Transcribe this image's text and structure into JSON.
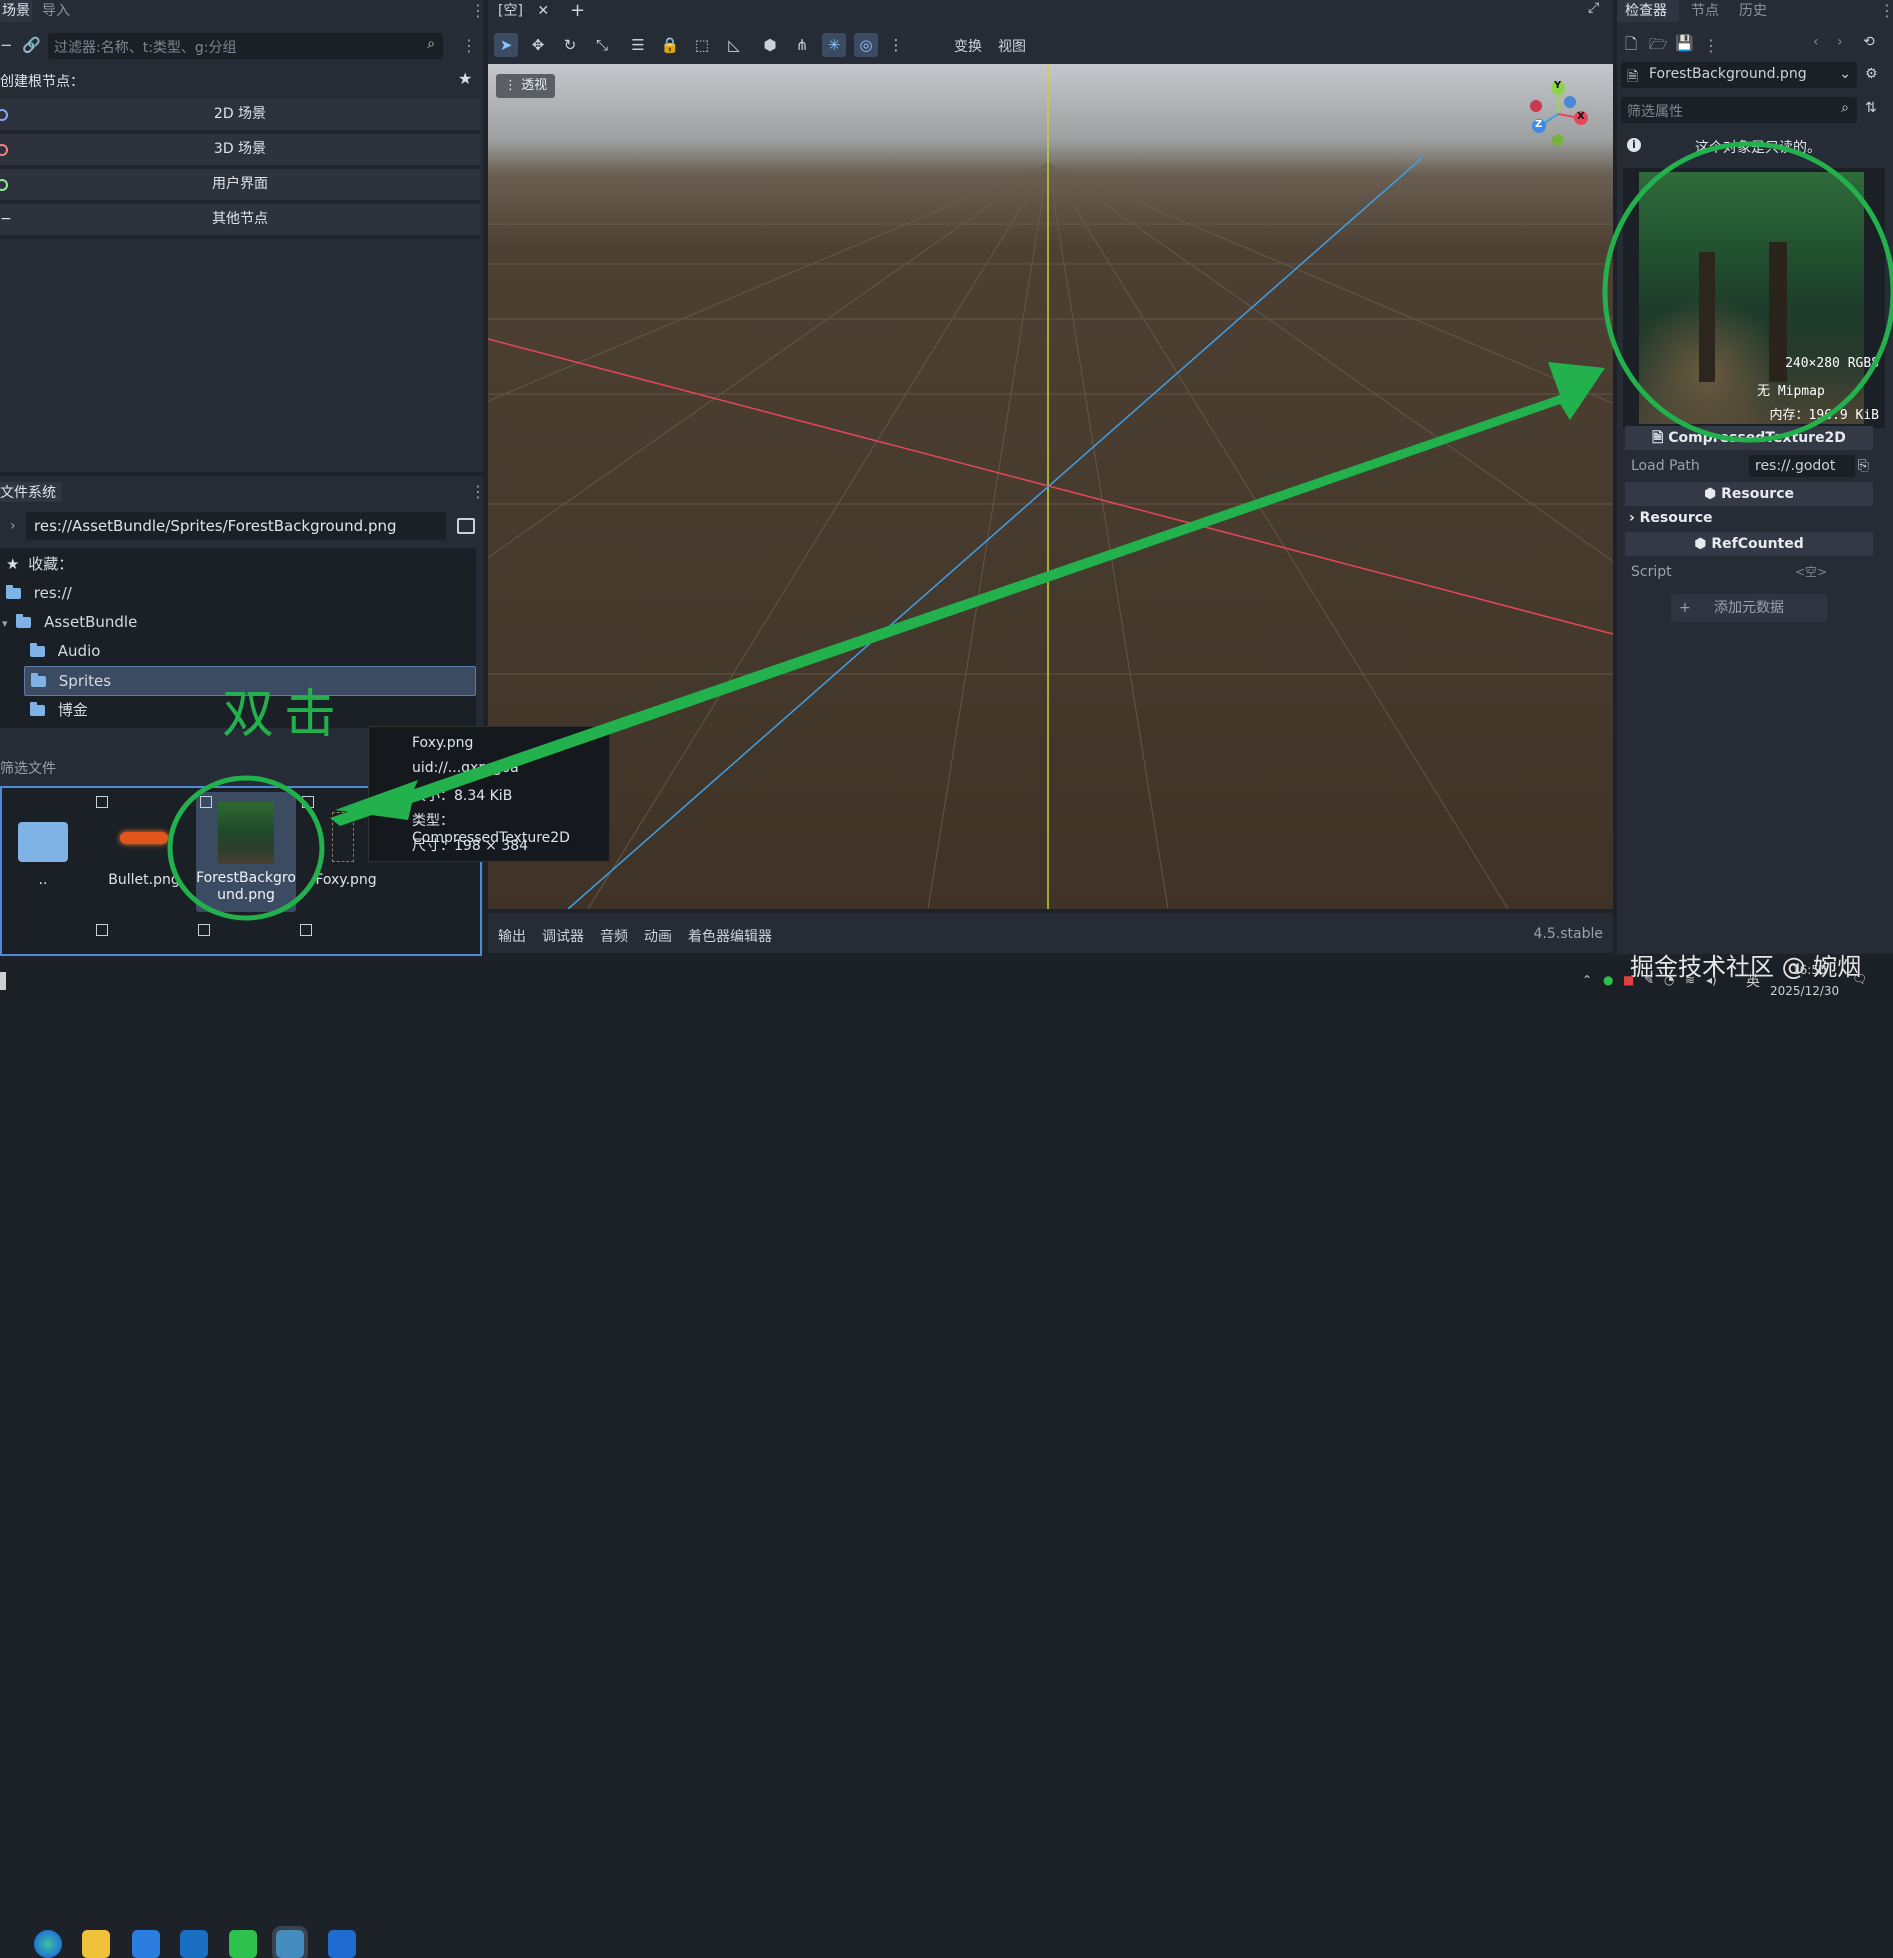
{
  "left_top": {
    "tabs": [
      "场景",
      "导入"
    ],
    "filter_placeholder": "过滤器:名称、t:类型、g:分组",
    "create_root_label": "创建根节点：",
    "node_buttons": [
      "2D 场景",
      "3D 场景",
      "用户界面",
      "其他节点"
    ]
  },
  "filesystem": {
    "title": "文件系统",
    "path": "res://AssetBundle/Sprites/ForestBackground.png",
    "tree": [
      {
        "label": "收藏："
      },
      {
        "label": "res://"
      },
      {
        "label": "AssetBundle"
      },
      {
        "label": "Audio"
      },
      {
        "label": "Sprites"
      },
      {
        "label": "博金"
      }
    ],
    "filter_files_label": "筛选文件",
    "files": [
      "..",
      "Bullet.png",
      "ForestBackground.png",
      "Foxy.png"
    ],
    "files_display": [
      "..",
      "Bullet.png",
      "ForestBackgro\nund.png",
      "Foxy.png"
    ],
    "handwriting": "双击"
  },
  "tooltip": {
    "name": "Foxy.png",
    "uid": "uid://...qxprgoa",
    "size": "大小：8.34 KiB",
    "type": "类型：CompressedTexture2D",
    "dims": "尺寸：198 × 384"
  },
  "viewport": {
    "scene_tab": "[空]",
    "menus": [
      "变换",
      "视图"
    ],
    "perspective_label": "透视",
    "gizmo_axes": [
      "Y",
      "X",
      "Z"
    ]
  },
  "bottom_bar": {
    "tabs": [
      "输出",
      "调试器",
      "音频",
      "动画",
      "着色器编辑器"
    ],
    "version": "4.5.stable"
  },
  "inspector": {
    "tabs": [
      "检查器",
      "节点",
      "历史"
    ],
    "resource_name": "ForestBackground.png",
    "filter_placeholder": "筛选属性",
    "readonly_notice": "这个对象是只读的。",
    "image_info": [
      "240×280 RGB8",
      "无 Mipmap",
      "内存：196.9 KiB"
    ],
    "class_header": "CompressedTexture2D",
    "load_path_label": "Load Path",
    "load_path_value": "res://.godot",
    "resource_header": "Resource",
    "resource_sub": "Resource",
    "refcounted_header": "RefCounted",
    "script_label": "Script",
    "script_value": "<空>",
    "add_metadata": "添加元数据"
  },
  "taskbar": {
    "time": "16:50",
    "date": "2025/12/30",
    "ime": "英"
  },
  "watermark": "掘金技术社区 @ 婉烟",
  "colors": {
    "accent_green": "#22b14c",
    "axis_red": "#e8455a",
    "axis_blue": "#3fa0e8",
    "axis_yellow": "#c6d62a",
    "ground": "#4a3d30",
    "selection": "#3a4b62"
  }
}
